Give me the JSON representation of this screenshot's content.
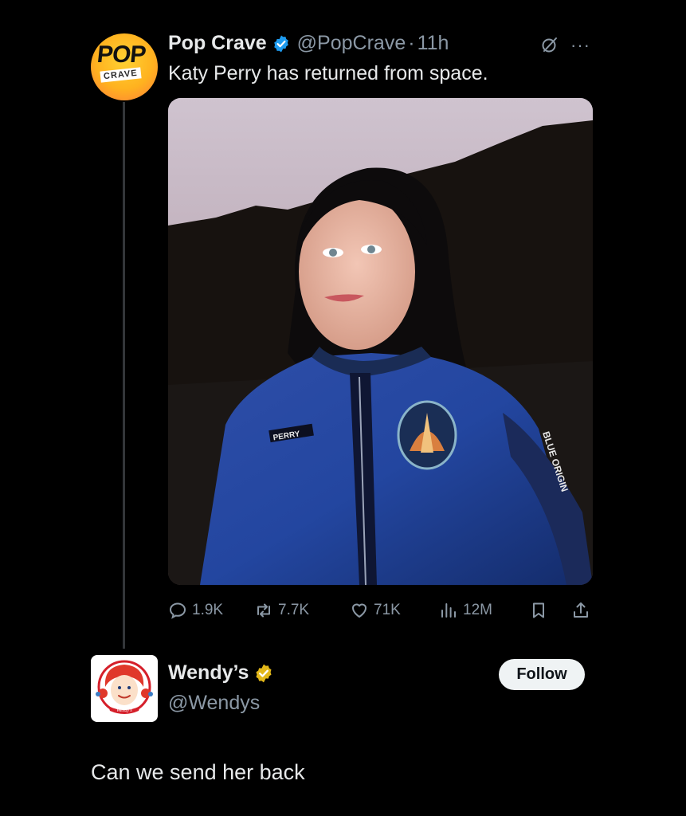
{
  "tweet": {
    "display_name": "Pop Crave",
    "handle": "@PopCrave",
    "separator": "·",
    "time": "11h",
    "text": "Katy Perry has returned from space.",
    "avatar": {
      "top_word": "POP",
      "bottom_word": "CRAVE"
    },
    "media": {
      "patch_text": "PERRY",
      "sleeve_text": "BLUE ORIGIN"
    },
    "stats": {
      "replies": "1.9K",
      "reposts": "7.7K",
      "likes": "71K",
      "views": "12M"
    },
    "icons": [
      "verified-icon",
      "grok-icon",
      "more-icon",
      "reply-icon",
      "retweet-icon",
      "heart-icon",
      "views-icon",
      "bookmark-icon",
      "share-icon"
    ]
  },
  "reply_card": {
    "display_name": "Wendy’s",
    "handle": "@Wendys",
    "follow_label": "Follow",
    "text": "Can we send her back",
    "avatar_word": "Wendy's"
  },
  "colors": {
    "background": "#000000",
    "text_primary": "#e7e9ea",
    "text_secondary": "#8b98a5",
    "verified_blue": "#1d9bf0",
    "verified_gold": "#e2b719"
  }
}
